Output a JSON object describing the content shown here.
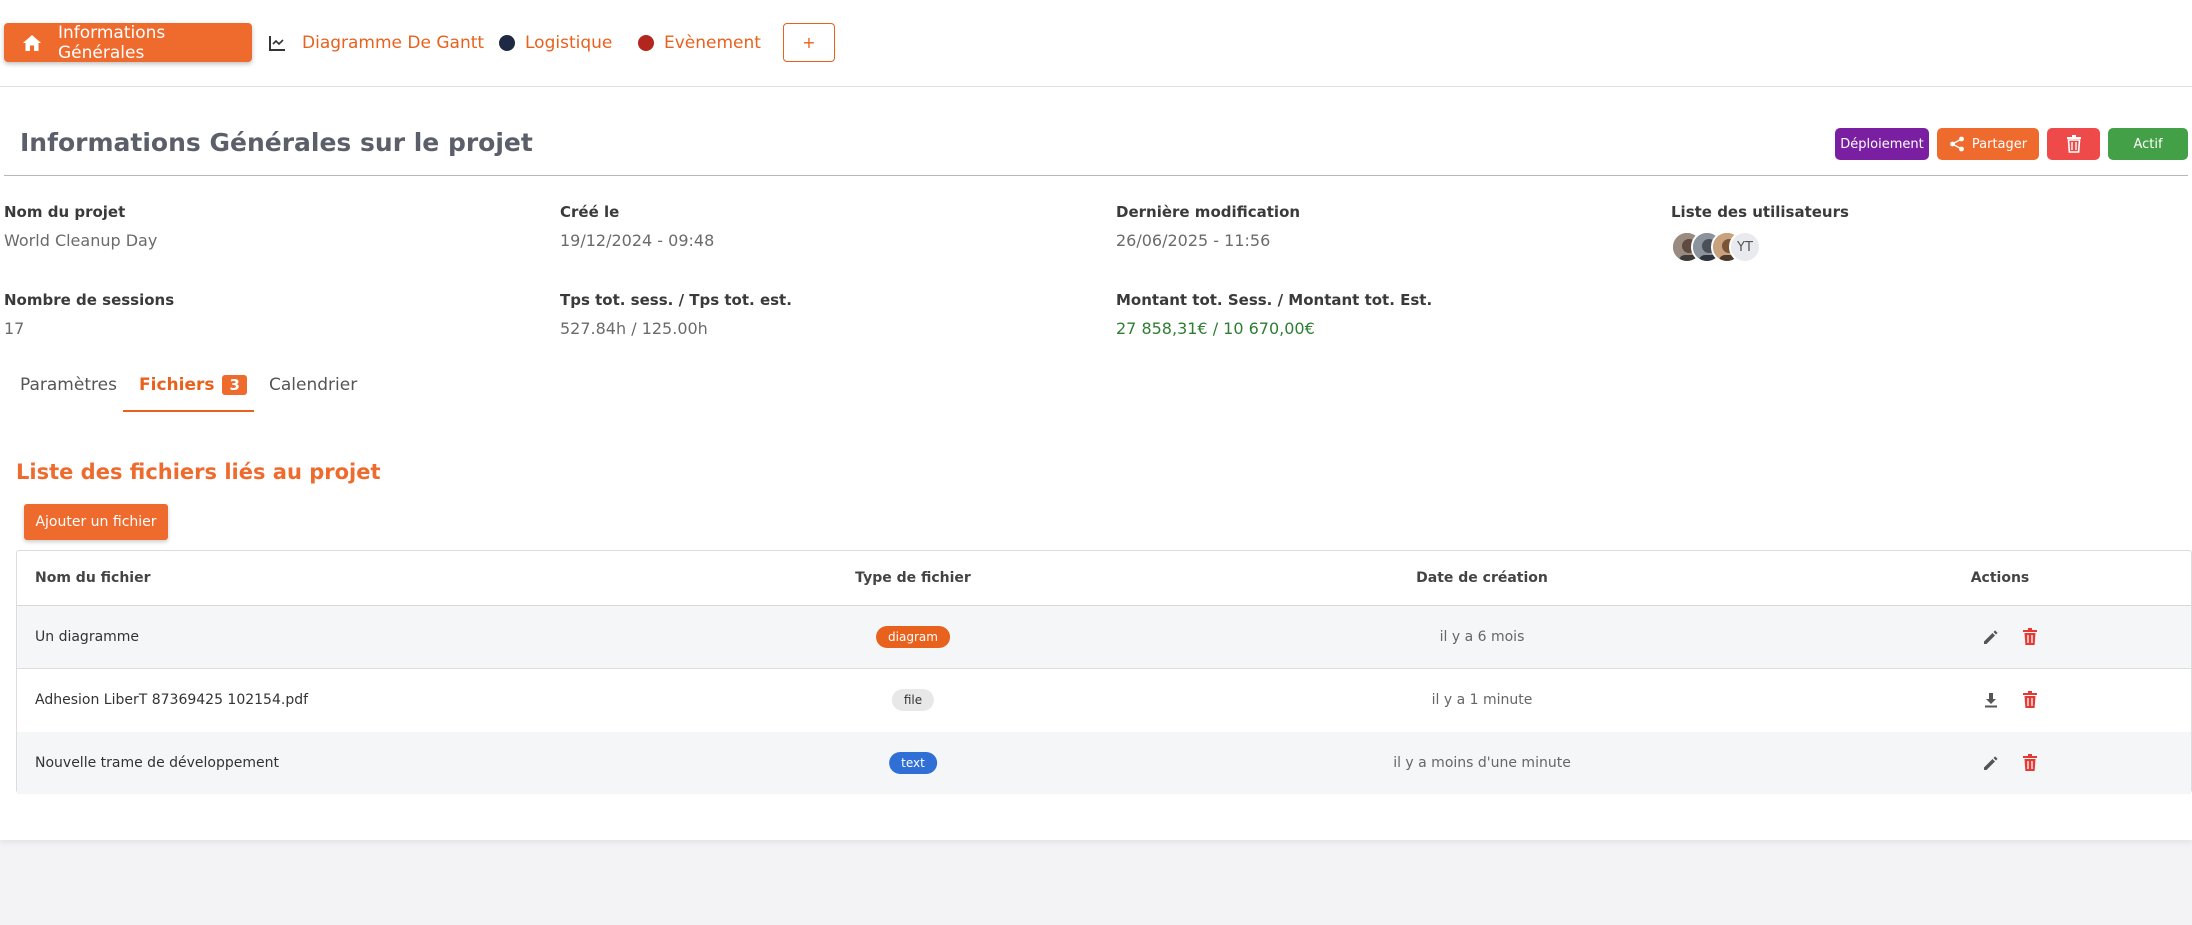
{
  "nav": {
    "active_label": "Informations Générales",
    "items": [
      {
        "label": "Diagramme De Gantt",
        "icon": "chart-axis-icon"
      },
      {
        "label": "Logistique",
        "icon": "dot-icon",
        "color": "#1e2a44"
      },
      {
        "label": "Evènement",
        "icon": "dot-icon",
        "color": "#b3261e"
      }
    ],
    "add_label": "+"
  },
  "header": {
    "title": "Informations Générales sur le projet",
    "buttons": {
      "deploy": "Déploiement",
      "share": "Partager",
      "status": "Actif"
    },
    "colors": {
      "deploy": "#7b1fa2",
      "share": "#ef6a2d",
      "delete": "#ef4a4a",
      "status": "#43a047"
    }
  },
  "info": {
    "project_name": {
      "label": "Nom du projet",
      "value": "World Cleanup Day"
    },
    "created": {
      "label": "Créé le",
      "value": "19/12/2024 - 09:48"
    },
    "modified": {
      "label": "Dernière modification",
      "value": "26/06/2025 - 11:56"
    },
    "users": {
      "label": "Liste des utilisateurs",
      "initials": "YT"
    },
    "sessions": {
      "label": "Nombre de sessions",
      "value": "17"
    },
    "time": {
      "label": "Tps tot. sess. / Tps tot. est.",
      "value": "527.84h / 125.00h"
    },
    "amount": {
      "label": "Montant tot. Sess. / Montant tot. Est.",
      "value": "27 858,31€ / 10 670,00€"
    }
  },
  "tabs": {
    "params": "Paramètres",
    "files": "Fichiers",
    "files_count": "3",
    "calendar": "Calendrier"
  },
  "files": {
    "title": "Liste des fichiers liés au projet",
    "add_button": "Ajouter un fichier",
    "columns": [
      "Nom du fichier",
      "Type de fichier",
      "Date de création",
      "Actions"
    ],
    "rows": [
      {
        "name": "Un diagramme",
        "type": "diagram",
        "date": "il y a 6 mois",
        "action": "edit-icon"
      },
      {
        "name": "Adhesion LiberT 87369425 102154.pdf",
        "type": "file",
        "date": "il y a 1 minute",
        "action": "download-icon"
      },
      {
        "name": "Nouvelle trame de développement",
        "type": "text",
        "date": "il y a moins d'une minute",
        "action": "edit-icon"
      }
    ],
    "type_colors": {
      "diagram": "#e8611d",
      "file": "#e8e8e8",
      "text": "#2f6fd6"
    }
  }
}
